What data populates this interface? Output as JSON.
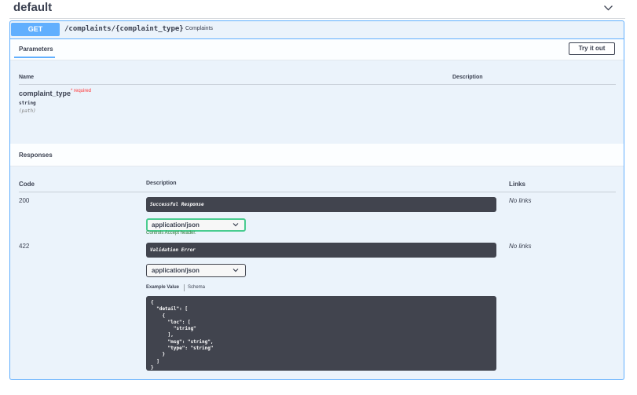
{
  "section": {
    "title": "default",
    "chevron_icon": "chevron-down-icon"
  },
  "operation": {
    "method": "GET",
    "path": "/complaints/{complaint_type}",
    "summary": "Complaints",
    "method_color": "#61affe",
    "bg_color": "#ebf3fb"
  },
  "parameters": {
    "tab_label": "Parameters",
    "try_button": "Try it out",
    "headers": {
      "name": "Name",
      "description": "Description"
    },
    "items": [
      {
        "name": "complaint_type",
        "required": "* required",
        "type": "string",
        "in": "(path)"
      }
    ]
  },
  "responses": {
    "title": "Responses",
    "headers": {
      "code": "Code",
      "description": "Description",
      "links": "Links"
    },
    "items": [
      {
        "code": "200",
        "description": "Successful Response",
        "links": "No links",
        "media_type": "application/json",
        "controls_note": "Controls Accept header."
      },
      {
        "code": "422",
        "description": "Validation Error",
        "links": "No links",
        "media_type": "application/json"
      }
    ],
    "example_tabs": {
      "active": "Example Value",
      "other": "Schema"
    },
    "example_value": "{\n  \"detail\": [\n    {\n      \"loc\": [\n        \"string\"\n      ],\n      \"msg\": \"string\",\n      \"type\": \"string\"\n    }\n  ]\n}"
  }
}
